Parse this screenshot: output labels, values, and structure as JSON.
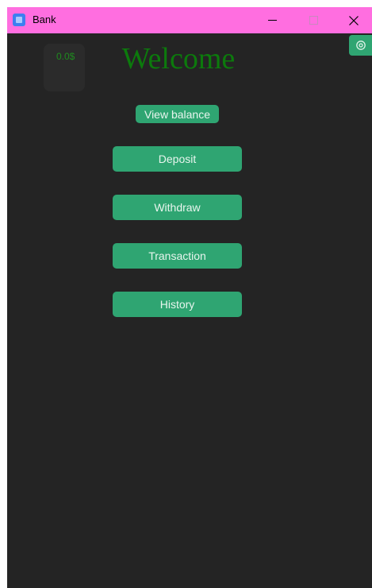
{
  "window": {
    "title": "Bank"
  },
  "balance": {
    "amount": "0.0$"
  },
  "header": {
    "welcome": "Welcome"
  },
  "buttons": {
    "view_balance": "View balance",
    "deposit": "Deposit",
    "withdraw": "Withdraw",
    "transaction": "Transaction",
    "history": "History"
  },
  "icons": {
    "app": "app-icon",
    "settings": "gear-icon",
    "minimize": "minimize-icon",
    "maximize": "maximize-icon",
    "close": "close-icon"
  },
  "colors": {
    "titlebar": "#ff6ee0",
    "background": "#242424",
    "accent": "#2fa572",
    "welcome_text": "#0c7a0c"
  }
}
